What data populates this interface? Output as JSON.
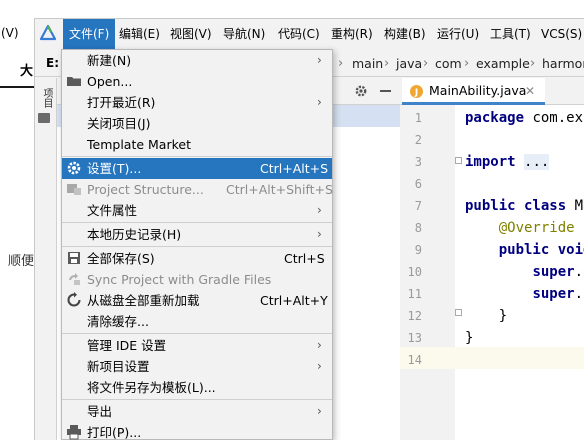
{
  "background_window": {
    "menu_fragment": "(V)",
    "tab_fragment": "大",
    "text_fragment": "顺便"
  },
  "menubar": {
    "items": [
      {
        "label": "文件(F)",
        "active": true
      },
      {
        "label": "编辑(E)"
      },
      {
        "label": "视图(V)"
      },
      {
        "label": "导航(N)"
      },
      {
        "label": "代码(C)"
      },
      {
        "label": "重构(R)"
      },
      {
        "label": "构建(B)"
      },
      {
        "label": "运行(U)"
      },
      {
        "label": "工具(T)"
      },
      {
        "label": "VCS(S)"
      }
    ]
  },
  "navbar": {
    "drive": "E:",
    "crumbs": [
      "main",
      "java",
      "com",
      "example",
      "harmon"
    ]
  },
  "project_panel": {
    "side_tab": "项目"
  },
  "editor": {
    "tab_label": "MainAbility.java",
    "line_numbers": [
      "1",
      "2",
      "3",
      "6",
      "7",
      "8",
      "9",
      "10",
      "11",
      "12",
      "13",
      "14"
    ],
    "code_lines": [
      {
        "num": "1",
        "text": "package com.exa"
      },
      {
        "num": "3",
        "text": "import ..."
      },
      {
        "num": "7",
        "text": "public class Ma"
      },
      {
        "num": "8",
        "text": "    @Override"
      },
      {
        "num": "9",
        "text": "    public void"
      },
      {
        "num": "10",
        "text": "        super.o"
      },
      {
        "num": "11",
        "text": "        super.s"
      },
      {
        "num": "12",
        "text": "    }"
      },
      {
        "num": "13",
        "text": "}"
      }
    ]
  },
  "file_menu": {
    "items": [
      {
        "label": "新建(N)",
        "submenu": true
      },
      {
        "label": "Open...",
        "icon": "folder-icon"
      },
      {
        "label": "打开最近(R)",
        "submenu": true
      },
      {
        "label": "关闭项目(J)"
      },
      {
        "label": "Template Market"
      },
      {
        "label": "设置(T)...",
        "shortcut": "Ctrl+Alt+S",
        "icon": "gear-icon",
        "highlighted": true
      },
      {
        "label": "Project Structure...",
        "shortcut": "Ctrl+Alt+Shift+S",
        "icon": "project-structure-icon",
        "disabled": true
      },
      {
        "label": "文件属性",
        "submenu": true
      },
      {
        "label": "本地历史记录(H)",
        "submenu": true
      },
      {
        "label": "全部保存(S)",
        "shortcut": "Ctrl+S",
        "icon": "save-icon"
      },
      {
        "label": "Sync Project with Gradle Files",
        "icon": "gradle-sync-icon",
        "disabled": true
      },
      {
        "label": "从磁盘全部重新加载",
        "shortcut": "Ctrl+Alt+Y",
        "icon": "reload-icon"
      },
      {
        "label": "清除缓存..."
      },
      {
        "label": "管理 IDE 设置",
        "submenu": true
      },
      {
        "label": "新项目设置",
        "submenu": true
      },
      {
        "label": "将文件另存为模板(L)..."
      },
      {
        "label": "导出",
        "submenu": true
      },
      {
        "label": "打印(P)...",
        "icon": "print-icon"
      }
    ]
  },
  "colors": {
    "highlight": "#2675bf",
    "menu_bg": "#f2f2f2",
    "keyword": "#000080",
    "annotation": "#808000"
  }
}
